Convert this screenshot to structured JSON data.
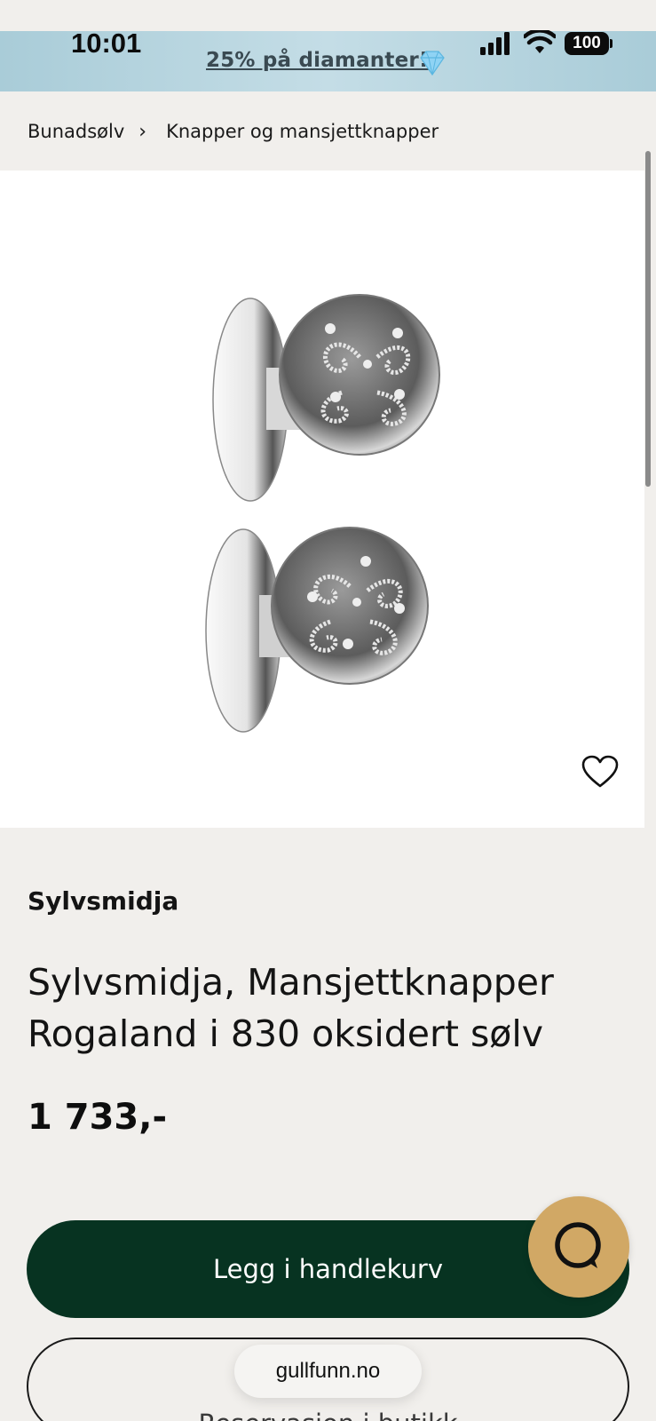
{
  "status_bar": {
    "time": "10:01",
    "battery": "100"
  },
  "banner": {
    "promo_text": "25% på diamanter!",
    "icon": "diamond-icon"
  },
  "breadcrumb": {
    "items": [
      "Bunadsølv",
      "Knapper og mansjettknapper"
    ],
    "separator": "›"
  },
  "product": {
    "image_icon": "cufflinks-image",
    "favorite_icon": "heart-icon",
    "brand": "Sylvsmidja",
    "title": "Sylvsmidja, Mansjettknapper Rogaland i 830 oksidert sølv",
    "price": "1 733,-"
  },
  "actions": {
    "add_to_cart": "Legg i handlekurv",
    "secondary": "Reservasjon i butikk",
    "chat_icon": "chat-bubble-icon"
  },
  "browser": {
    "url": "gullfunn.no"
  },
  "colors": {
    "primary_button": "#073321",
    "chat_button": "#d1a865",
    "banner": "#b8d6e0",
    "page_bg": "#f1efec"
  }
}
